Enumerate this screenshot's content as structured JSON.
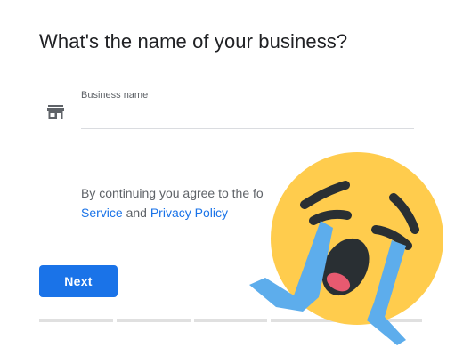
{
  "header": {
    "title": "What's the name of your business?"
  },
  "business_field": {
    "label": "Business name",
    "value": "",
    "icon": "store-icon"
  },
  "terms": {
    "prefix": "By continuing you agree to the fo",
    "service_link": "Service",
    "and": " and ",
    "privacy_link": "Privacy Policy"
  },
  "actions": {
    "next_label": "Next"
  },
  "progress": {
    "segments": 5,
    "current_step": 1
  },
  "overlay": {
    "icon": "loudly-crying-face-emoji"
  },
  "colors": {
    "accent": "#1a73e8",
    "text": "#202124",
    "muted": "#5f6368",
    "emoji_face": "#FFCC4D",
    "emoji_tears": "#5DADEC"
  }
}
